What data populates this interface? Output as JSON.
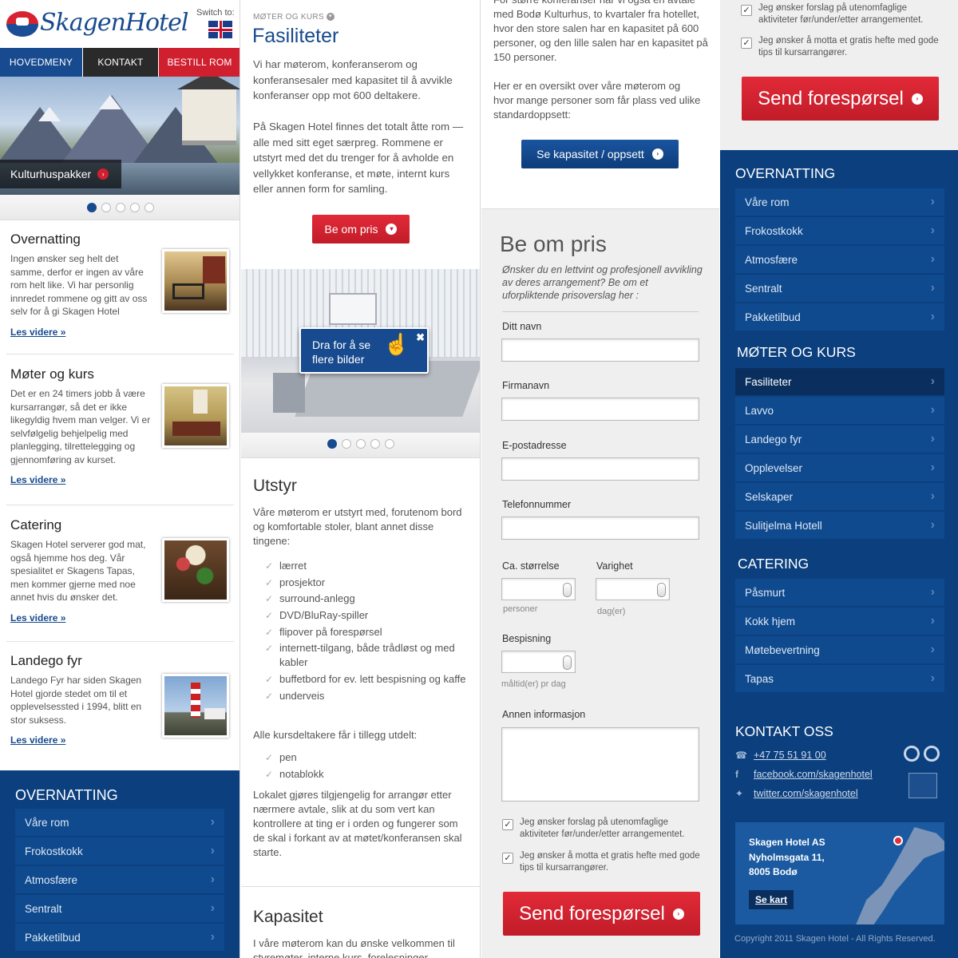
{
  "brand": {
    "logo_text": "SkagenHotel",
    "switch_label": "Switch to:",
    "accent_blue": "#174a8e",
    "accent_red": "#d0202f",
    "panel_blue": "#0b3f7e"
  },
  "nav": {
    "main": "HOVEDMENY",
    "contact": "KONTAKT",
    "book": "BESTILL ROM"
  },
  "hero": {
    "caption": "Kulturhuspakker",
    "dots": 5,
    "active_dot": 1
  },
  "left_items": [
    {
      "title": "Overnatting",
      "text": "Ingen ønsker seg helt det samme, derfor er ingen av våre rom helt like.  Vi har personlig innredet rommene og gitt av oss selv for å gi Skagen Hotel",
      "more": "Les videre »"
    },
    {
      "title": "Møter og kurs",
      "text": "Det er en 24 timers jobb å være kursarrangør, så det er ikke likegyldig hvem man velger.  Vi er selvfølgelig behjelpelig med planlegging, tilrettelegging og gjennomføring av kurset.",
      "more": "Les videre »"
    },
    {
      "title": "Catering",
      "text": "Skagen Hotel serverer god mat, også hjemme hos deg. Vår spesialitet er Skagens Tapas, men kommer gjerne med noe annet hvis du ønsker det.",
      "more": "Les videre »"
    },
    {
      "title": "Landego fyr",
      "text": "Landego Fyr har siden Skagen Hotel gjorde stedet om til et opplevelsessted i 1994, blitt en stor suksess.",
      "more": "Les videre »"
    }
  ],
  "left_menu": {
    "title": "OVERNATTING",
    "items": [
      "Våre rom",
      "Frokostkokk",
      "Atmosfære",
      "Sentralt",
      "Pakketilbud"
    ]
  },
  "main": {
    "breadcrumb": "MØTER OG KURS",
    "title": "Fasiliteter",
    "intro": "Vi har møterom, konferanserom og konferansesaler med kapasitet til å avvikle konferanser opp mot 600 deltakere.",
    "para2": "På Skagen Hotel finnes det totalt åtte rom — alle med sitt eget særpreg. Rommene er utstyrt med det du trenger for å avholde en vellykket konferanse, et møte, internt kurs eller annen form for samling.",
    "price_button": "Be om pris",
    "tooltip": "Dra for å se flere bilder",
    "gallery_dots": 5,
    "equip_title": "Utstyr",
    "equip_intro": "Våre møterom er utstyrt med, forutenom bord og komfortable stoler, blant annet disse tingene:",
    "equipment": [
      "lærret",
      "prosjektor",
      "surround-anlegg",
      "DVD/BluRay-spiller",
      "flipover på forespørsel",
      "internett-tilgang, både trådløst og med kabler",
      "buffetbord for ev. lett bespisning og kaffe",
      "underveis"
    ],
    "extra_intro": "Alle kursdeltakere får i tillegg utdelt:",
    "extras": [
      "pen",
      "notablokk"
    ],
    "note": "Lokalet gjøres tilgjengelig for arrangør etter nærmere avtale, slik at du som vert kan kontrollere at ting er i orden og fungerer som de skal i forkant av at møtet/konferansen skal starte.",
    "cap_title": "Kapasitet",
    "cap_text": "I våre møterom kan du ønske velkommen til styremøter, interne kurs, forelesninger"
  },
  "col3": {
    "top_text": "For større konferanser har vi også en avtale med Bodø Kulturhus, to kvartaler fra hotellet, hvor den store salen har en kapasitet på 600 personer, og den lille salen har en kapasitet på 150 personer.",
    "top_text2": "Her er en oversikt over våre møterom og hvor mange personer som får plass ved ulike standardoppsett:",
    "capacity_button": "Se kapasitet / oppsett",
    "form_title": "Be om pris",
    "form_intro": "Ønsker du en lettvint og profesjonell avvikling av deres arrangement? Be om et uforpliktende prisoverslag her :",
    "fields": {
      "name": "Ditt navn",
      "company": "Firmanavn",
      "email": "E-postadresse",
      "phone": "Telefonnummer",
      "size": "Ca. størrelse",
      "size_unit": "personer",
      "duration": "Varighet",
      "duration_unit": "dag(er)",
      "meals": "Bespisning",
      "meals_unit": "måltid(er) pr dag",
      "other": "Annen informasjon"
    },
    "checks": [
      "Jeg ønsker forslag på utenomfaglige aktiviteter før/under/etter arrangementet.",
      "Jeg ønsker å motta et gratis hefte med gode tips til kursarrangører."
    ],
    "submit": "Send forespørsel"
  },
  "col4": {
    "checks": [
      "Jeg ønsker forslag på utenomfaglige aktiviteter før/under/etter arrangementet.",
      "Jeg ønsker å motta et gratis hefte med gode tips til kursarrangører."
    ],
    "submit": "Send forespørsel",
    "menus": [
      {
        "title": "OVERNATTING",
        "items": [
          "Våre rom",
          "Frokostkokk",
          "Atmosfære",
          "Sentralt",
          "Pakketilbud"
        ]
      },
      {
        "title": "MØTER OG KURS",
        "items": [
          "Fasiliteter",
          "Lavvo",
          "Landego fyr",
          "Opplevelser",
          "Selskaper",
          "Sulitjelma Hotell"
        ]
      },
      {
        "title": "CATERING",
        "items": [
          "Påsmurt",
          "Kokk hjem",
          "Møtebevertning",
          "Tapas"
        ]
      }
    ],
    "contact_title": "KONTAKT OSS",
    "phone": "+47 75 51 91 00",
    "facebook": "facebook.com/skagenhotel",
    "twitter": "twitter.com/skagenhotel",
    "address": [
      "Skagen Hotel AS",
      "Nyholmsgata 11,",
      "8005 Bodø"
    ],
    "map_button": "Se kart",
    "copyright": "Copyright 2011 Skagen Hotel - All Rights Reserved."
  }
}
